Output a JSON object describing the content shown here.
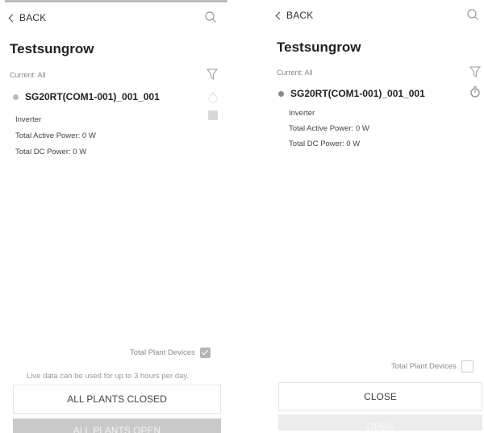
{
  "left": {
    "back_label": "BACK",
    "plant_title": "Testsungrow",
    "current_filter": "Current: All",
    "device": {
      "name": "SG20RT(COM1-001)_001_001",
      "type": "Inverter",
      "active_power": "Total Active Power: 0 W",
      "dc_power": "Total DC Power: 0 W"
    },
    "total_plant_devices_label": "Total Plant Devices",
    "total_plant_devices_checked": true,
    "note": "Live data can be used for up to 3 hours per day.",
    "closed_button": "ALL PLANTS CLOSED",
    "open_button": "ALL PLANTS OPEN"
  },
  "right": {
    "back_label": "BACK",
    "plant_title": "Testsungrow",
    "current_filter": "Current: All",
    "device": {
      "name": "SG20RT(COM1-001)_001_001",
      "type": "Inverter",
      "active_power": "Total Active Power: 0 W",
      "dc_power": "Total DC Power: 0 W"
    },
    "total_plant_devices_label": "Total Plant Devices",
    "total_plant_devices_checked": false,
    "close_button": "CLOSE",
    "open_button": "OPEN"
  },
  "icons": {
    "back": "chevron-left-icon",
    "search": "search-icon",
    "filter": "filter-icon",
    "timer": "stopwatch-icon",
    "status": "status-dot-icon"
  }
}
